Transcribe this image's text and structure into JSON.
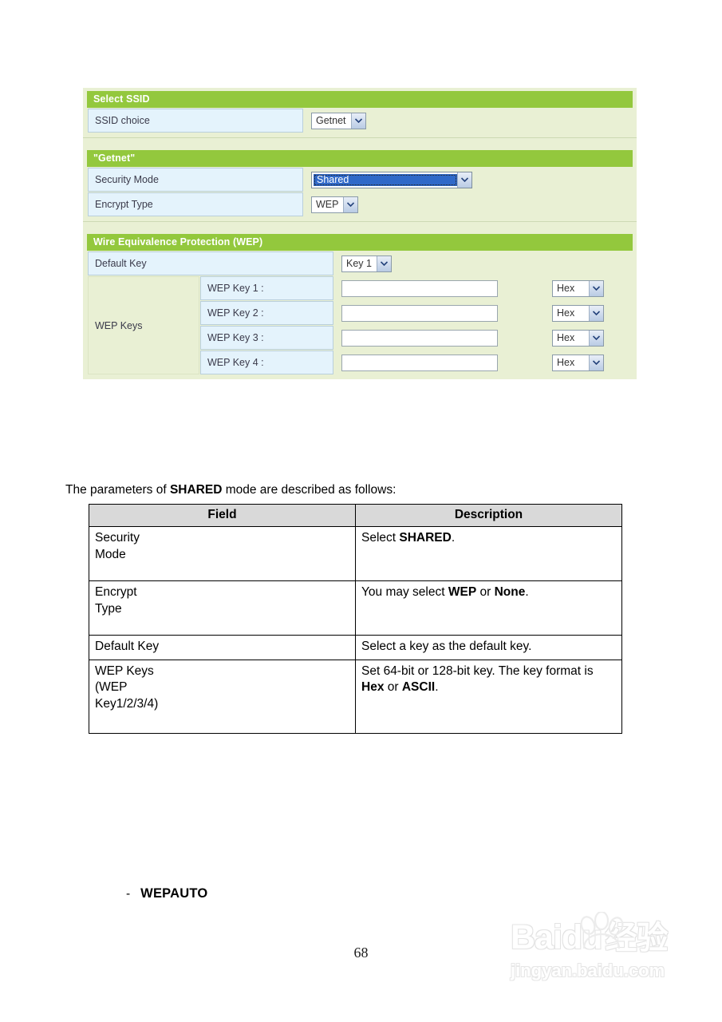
{
  "router_ui": {
    "panels": [
      {
        "title": "Select SSID",
        "rows": [
          {
            "label": "SSID choice",
            "control": "select",
            "value": "Getnet"
          }
        ]
      },
      {
        "title": "\"Getnet\"",
        "rows": [
          {
            "label": "Security Mode",
            "control": "select-focused",
            "value": "Shared"
          },
          {
            "label": "Encrypt Type",
            "control": "select",
            "value": "WEP"
          }
        ]
      },
      {
        "title": "Wire Equivalence Protection (WEP)",
        "rows": [
          {
            "label": "Default Key",
            "control": "select",
            "value": "Key 1"
          }
        ],
        "wep_keys_label": "WEP Keys",
        "wep_keys": [
          {
            "label": "WEP Key 1 :",
            "value": "",
            "format": "Hex"
          },
          {
            "label": "WEP Key 2 :",
            "value": "",
            "format": "Hex"
          },
          {
            "label": "WEP Key 3 :",
            "value": "",
            "format": "Hex"
          },
          {
            "label": "WEP Key 4 :",
            "value": "",
            "format": "Hex"
          }
        ]
      }
    ],
    "colors": {
      "header_green": "#93c83d",
      "panel_bg": "#e9f0d4",
      "label_blue": "#e4f3fc",
      "selection_blue": "#3069c8"
    }
  },
  "intro": {
    "prefix": "The parameters of ",
    "keyword": "SHARED",
    "suffix": " mode are described as follows:"
  },
  "desc_table": {
    "headers": [
      "Field",
      "Description"
    ],
    "rows": [
      {
        "field": "Security\nMode",
        "desc_parts": [
          {
            "t": "Select ",
            "b": false
          },
          {
            "t": "SHARED",
            "b": true
          },
          {
            "t": ".",
            "b": false
          }
        ],
        "min_height": 58
      },
      {
        "field": "Encrypt\nType",
        "desc_parts": [
          {
            "t": "You may select ",
            "b": false
          },
          {
            "t": "WEP",
            "b": true
          },
          {
            "t": " or ",
            "b": false
          },
          {
            "t": "None",
            "b": true
          },
          {
            "t": ".",
            "b": false
          }
        ],
        "min_height": 58
      },
      {
        "field": "Default Key",
        "desc_parts": [
          {
            "t": "Select a key as the default key.",
            "b": false
          }
        ],
        "min_height": 0
      },
      {
        "field": "WEP Keys\n(WEP\nKey1/2/3/4)",
        "desc_parts": [
          {
            "t": "Set 64-bit or 128-bit key. The key format is ",
            "b": false
          },
          {
            "t": "Hex",
            "b": true
          },
          {
            "t": " or ",
            "b": false
          },
          {
            "t": "ASCII",
            "b": true
          },
          {
            "t": ".",
            "b": false
          }
        ],
        "min_height": 82
      }
    ]
  },
  "footer": {
    "bullet_dash": "-",
    "bullet_text": "WEPAUTO",
    "page_number": "68"
  },
  "watermark": {
    "main_latin": "Baidu",
    "main_cn": "经验",
    "sub": "jingyan.baidu.com"
  }
}
